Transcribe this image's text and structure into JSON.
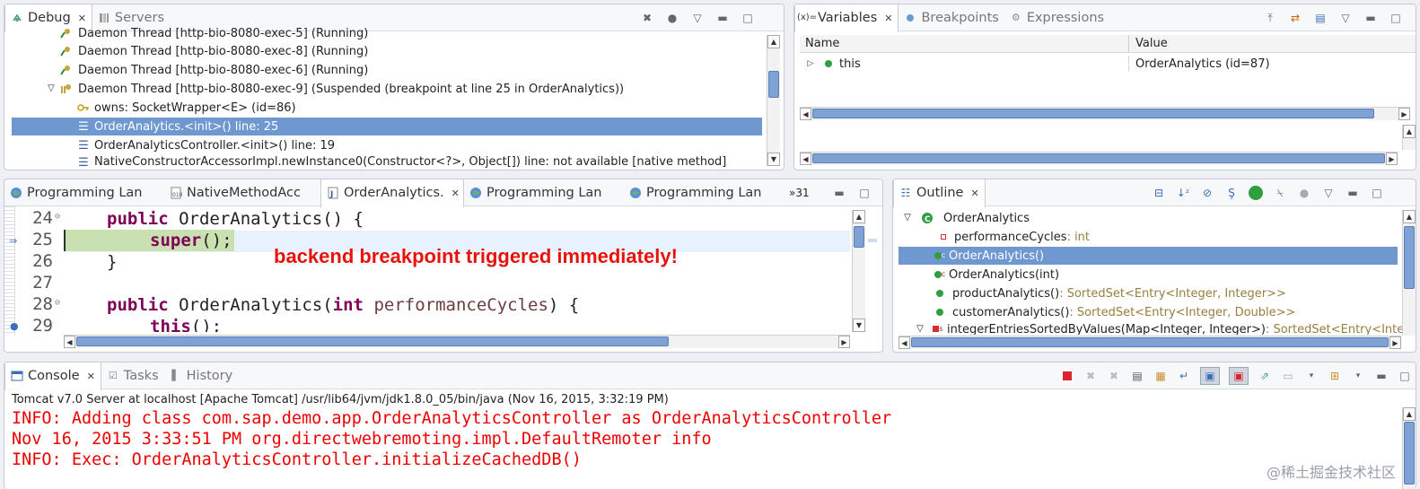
{
  "debug": {
    "tabs": [
      {
        "label": "Debug"
      },
      {
        "label": "Servers"
      }
    ],
    "threads": [
      {
        "label": "Daemon Thread [http-bio-8080-exec-5] (Running)"
      },
      {
        "label": "Daemon Thread [http-bio-8080-exec-8] (Running)"
      },
      {
        "label": "Daemon Thread [http-bio-8080-exec-6] (Running)"
      },
      {
        "label": "Daemon Thread [http-bio-8080-exec-9] (Suspended (breakpoint at line 25 in OrderAnalytics))"
      }
    ],
    "owns": "owns: SocketWrapper<E>  (id=86)",
    "frames": [
      {
        "label": "OrderAnalytics.<init>() line: 25"
      },
      {
        "label": "OrderAnalyticsController.<init>() line: 19"
      },
      {
        "label": "NativeConstructorAccessorImpl.newInstance0(Constructor<?>, Object[]) line: not available [native method]"
      }
    ]
  },
  "variables": {
    "tabs": [
      {
        "label": "Variables"
      },
      {
        "label": "Breakpoints"
      },
      {
        "label": "Expressions"
      }
    ],
    "col_name": "Name",
    "col_value": "Value",
    "rows": [
      {
        "name": "this",
        "value": "OrderAnalytics  (id=87)"
      }
    ]
  },
  "editor": {
    "tabs": [
      {
        "label": "Programming Lan"
      },
      {
        "label": "NativeMethodAcc"
      },
      {
        "label": "OrderAnalytics."
      },
      {
        "label": "Programming Lan"
      },
      {
        "label": "Programming Lan"
      }
    ],
    "overflow": "»31",
    "lines": [
      {
        "num": "24",
        "kw": "public",
        "text": " OrderAnalytics() {"
      },
      {
        "num": "25",
        "kw": "super",
        "text": "();"
      },
      {
        "num": "26",
        "text": "}"
      },
      {
        "num": "27",
        "text": ""
      },
      {
        "num": "28",
        "kw": "public",
        "text": " OrderAnalytics(",
        "kw2": "int",
        "param": " performanceCycles",
        "text2": ") {"
      },
      {
        "num": "29",
        "kw": "this",
        "text": "();"
      }
    ],
    "annotation": "backend breakpoint triggered immediately!",
    "annotation_color": "#e8120c"
  },
  "outline": {
    "tab": "Outline",
    "root": "OrderAnalytics",
    "items": [
      {
        "name": "performanceCycles",
        "type": " : int"
      },
      {
        "name": "OrderAnalytics()",
        "type": ""
      },
      {
        "name": "OrderAnalytics(int)",
        "type": ""
      },
      {
        "name": "productAnalytics()",
        "type": " : SortedSet<Entry<Integer, Integer>>"
      },
      {
        "name": "customerAnalytics()",
        "type": " : SortedSet<Entry<Integer, Double>>"
      },
      {
        "name": "integerEntriesSortedByValues(Map<Integer, Integer>)",
        "type": " : SortedSet<Entry<Inte"
      }
    ]
  },
  "console": {
    "tabs": [
      {
        "label": "Console"
      },
      {
        "label": "Tasks"
      },
      {
        "label": "History"
      }
    ],
    "header": "Tomcat v7.0 Server at localhost [Apache Tomcat] /usr/lib64/jvm/jdk1.8.0_05/bin/java (Nov 16, 2015, 3:32:19 PM)",
    "lines": [
      "INFO: Adding class com.sap.demo.app.OrderAnalyticsController as OrderAnalyticsController",
      "Nov 16, 2015 3:33:51 PM org.directwebremoting.impl.DefaultRemoter info",
      "INFO: Exec: OrderAnalyticsController.initializeCachedDB()"
    ],
    "text_color": "#e00000"
  },
  "watermark": "@稀土掘金技术社区",
  "colors": {
    "selection": "#6f97d0",
    "keyword": "#7f0055",
    "breakpoint_line": "#c9e0b0"
  }
}
